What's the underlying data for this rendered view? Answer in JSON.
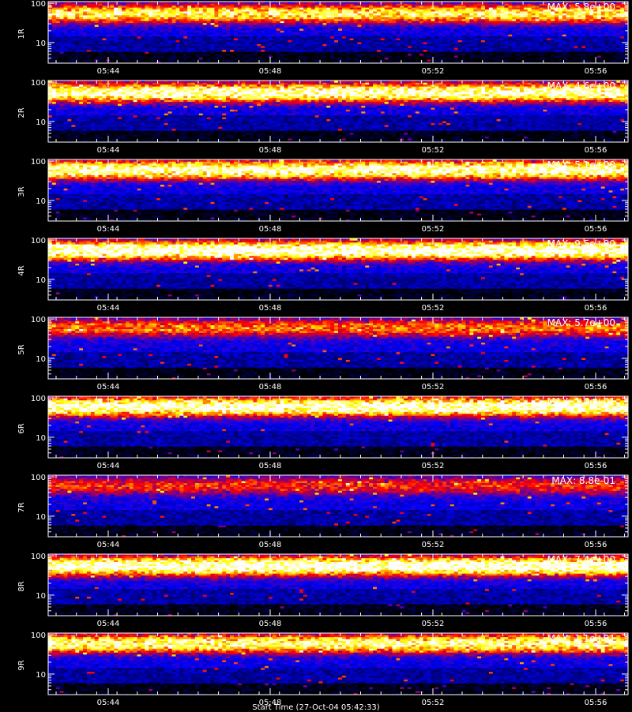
{
  "x_axis": {
    "ticks": [
      "05:44",
      "05:48",
      "05:52",
      "05:56"
    ],
    "title": "Start Time (27-Oct-04 05:42:33)"
  },
  "panels": [
    {
      "label": "1R",
      "max": "MAX: 5.8e+00"
    },
    {
      "label": "2R",
      "max": "MAX: 4.6e+00"
    },
    {
      "label": "3R",
      "max": "MAX: 5.1e+00"
    },
    {
      "label": "4R",
      "max": "MAX: 9.5e+00"
    },
    {
      "label": "5R",
      "max": "MAX: 5.7e+00"
    },
    {
      "label": "6R",
      "max": "MAX: 1.0e+01"
    },
    {
      "label": "7R",
      "max": "MAX: 8.8e-01"
    },
    {
      "label": "8R",
      "max": "MAX: 7.4e+00"
    },
    {
      "label": "9R",
      "max": "MAX: 1.1e+01"
    }
  ],
  "chart_data": {
    "type": "heatmap",
    "panel_count": 9,
    "ylim": [
      3,
      110
    ],
    "y_scale": "log",
    "y_ticks": [
      "10",
      "100"
    ],
    "x_ticks": [
      "05:44",
      "05:48",
      "05:52",
      "05:56"
    ],
    "colormap": [
      "#000000",
      "#0000ff",
      "#ff0000",
      "#ffff00",
      "#ffffff"
    ],
    "peak_bands": [
      {
        "panel": "1R",
        "center": 55,
        "strength": 0.7
      },
      {
        "panel": "2R",
        "center": 55,
        "strength": 0.9
      },
      {
        "panel": "3R",
        "center": 60,
        "strength": 0.9
      },
      {
        "panel": "4R",
        "center": 55,
        "strength": 1.0
      },
      {
        "panel": "5R",
        "center": 60,
        "strength": 0.45
      },
      {
        "panel": "6R",
        "center": 60,
        "strength": 0.95
      },
      {
        "panel": "7R",
        "center": 60,
        "strength": 0.35
      },
      {
        "panel": "8R",
        "center": 55,
        "strength": 1.0
      },
      {
        "panel": "9R",
        "center": 60,
        "strength": 0.8
      }
    ]
  }
}
